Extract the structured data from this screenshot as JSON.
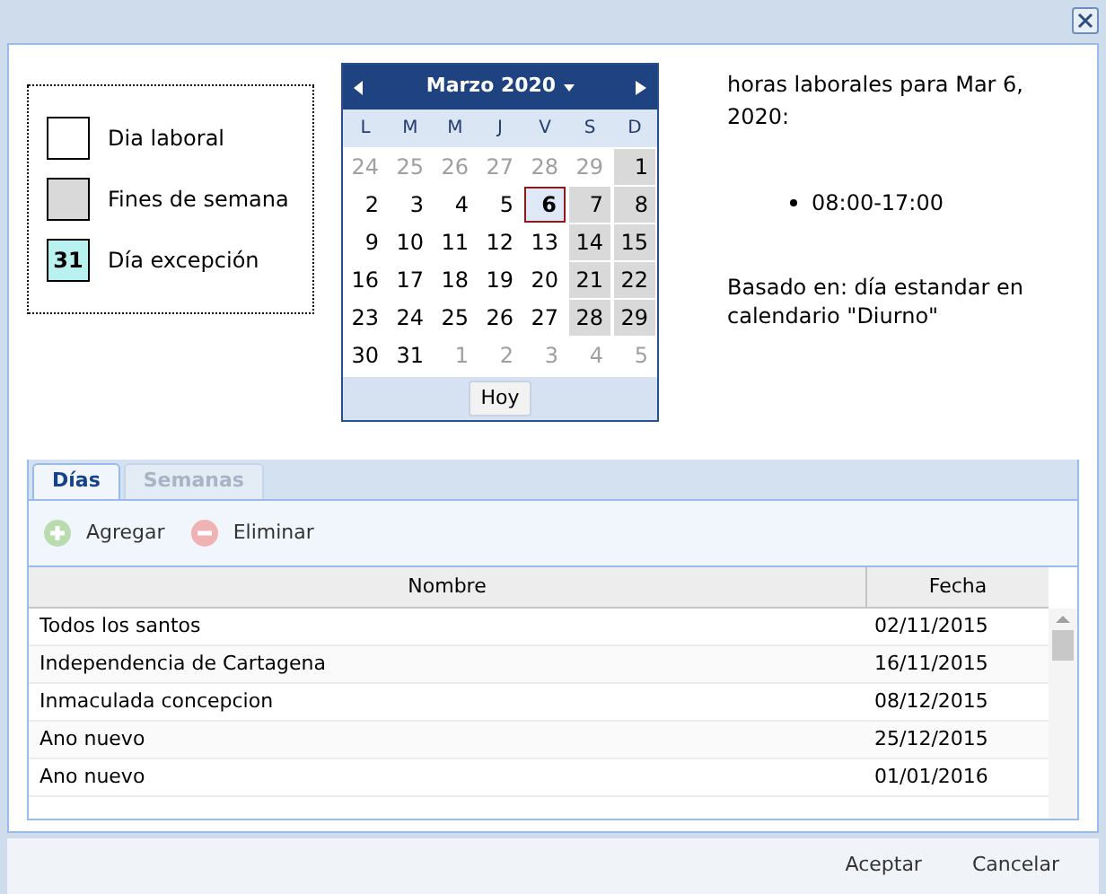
{
  "legend": [
    {
      "kind": "workday",
      "label": "Dia laboral"
    },
    {
      "kind": "weekend",
      "label": "Fines de semana"
    },
    {
      "kind": "exception",
      "label": "Día excepción",
      "sample": "31"
    }
  ],
  "calendar": {
    "month": "Marzo 2020",
    "weekdays": [
      "L",
      "M",
      "M",
      "J",
      "V",
      "S",
      "D"
    ],
    "days": [
      {
        "day": "24",
        "kind": "other",
        "selected": false
      },
      {
        "day": "25",
        "kind": "other",
        "selected": false
      },
      {
        "day": "26",
        "kind": "other",
        "selected": false
      },
      {
        "day": "27",
        "kind": "other",
        "selected": false
      },
      {
        "day": "28",
        "kind": "other",
        "selected": false
      },
      {
        "day": "29",
        "kind": "other",
        "selected": false
      },
      {
        "day": "1",
        "kind": "weekend",
        "selected": false
      },
      {
        "day": "2",
        "kind": "normal",
        "selected": false
      },
      {
        "day": "3",
        "kind": "normal",
        "selected": false
      },
      {
        "day": "4",
        "kind": "normal",
        "selected": false
      },
      {
        "day": "5",
        "kind": "normal",
        "selected": false
      },
      {
        "day": "6",
        "kind": "normal",
        "selected": true
      },
      {
        "day": "7",
        "kind": "weekend",
        "selected": false
      },
      {
        "day": "8",
        "kind": "weekend",
        "selected": false
      },
      {
        "day": "9",
        "kind": "normal",
        "selected": false
      },
      {
        "day": "10",
        "kind": "normal",
        "selected": false
      },
      {
        "day": "11",
        "kind": "normal",
        "selected": false
      },
      {
        "day": "12",
        "kind": "normal",
        "selected": false
      },
      {
        "day": "13",
        "kind": "normal",
        "selected": false
      },
      {
        "day": "14",
        "kind": "weekend",
        "selected": false
      },
      {
        "day": "15",
        "kind": "weekend",
        "selected": false
      },
      {
        "day": "16",
        "kind": "normal",
        "selected": false
      },
      {
        "day": "17",
        "kind": "normal",
        "selected": false
      },
      {
        "day": "18",
        "kind": "normal",
        "selected": false
      },
      {
        "day": "19",
        "kind": "normal",
        "selected": false
      },
      {
        "day": "20",
        "kind": "normal",
        "selected": false
      },
      {
        "day": "21",
        "kind": "weekend",
        "selected": false
      },
      {
        "day": "22",
        "kind": "weekend",
        "selected": false
      },
      {
        "day": "23",
        "kind": "normal",
        "selected": false
      },
      {
        "day": "24",
        "kind": "normal",
        "selected": false
      },
      {
        "day": "25",
        "kind": "normal",
        "selected": false
      },
      {
        "day": "26",
        "kind": "normal",
        "selected": false
      },
      {
        "day": "27",
        "kind": "normal",
        "selected": false
      },
      {
        "day": "28",
        "kind": "weekend",
        "selected": false
      },
      {
        "day": "29",
        "kind": "weekend",
        "selected": false
      },
      {
        "day": "30",
        "kind": "normal",
        "selected": false
      },
      {
        "day": "31",
        "kind": "normal",
        "selected": false
      },
      {
        "day": "1",
        "kind": "other",
        "selected": false
      },
      {
        "day": "2",
        "kind": "other",
        "selected": false
      },
      {
        "day": "3",
        "kind": "other",
        "selected": false
      },
      {
        "day": "4",
        "kind": "other",
        "selected": false
      },
      {
        "day": "5",
        "kind": "other",
        "selected": false
      }
    ],
    "today_button": "Hoy"
  },
  "info": {
    "title": "horas laborales para Mar 6, 2020:",
    "hours": [
      "08:00-17:00"
    ],
    "based_on": "Basado en: día estandar en calendario \"Diurno\""
  },
  "tabs": [
    {
      "label": "Días",
      "selected": true
    },
    {
      "label": "Semanas",
      "selected": false
    }
  ],
  "toolbar": [
    {
      "kind": "add",
      "label": "Agregar"
    },
    {
      "kind": "remove",
      "label": "Eliminar"
    }
  ],
  "table": {
    "columns": [
      "Nombre",
      "Fecha"
    ],
    "rows": [
      {
        "name": "Todos los santos",
        "date": "02/11/2015"
      },
      {
        "name": "Independencia de Cartagena",
        "date": "16/11/2015"
      },
      {
        "name": "Inmaculada concepcion",
        "date": "08/12/2015"
      },
      {
        "name": "Ano nuevo",
        "date": "25/12/2015"
      },
      {
        "name": "Ano nuevo",
        "date": "01/01/2016"
      }
    ]
  },
  "buttons": [
    "Aceptar",
    "Cancelar"
  ]
}
